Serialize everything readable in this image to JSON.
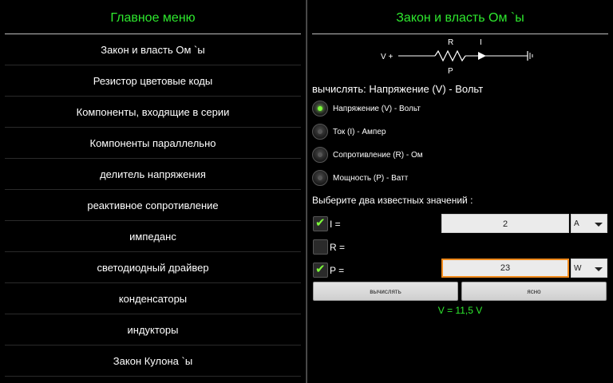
{
  "menu_pane": {
    "title": "Главное меню",
    "items": [
      "Закон и власть Ом `ы",
      "Резистор цветовые коды",
      "Компоненты, входящие в серии",
      "Компоненты параллельно",
      "делитель напряжения",
      "реактивное сопротивление",
      "импеданс",
      "светодиодный драйвер",
      "конденсаторы",
      "индукторы",
      "Закон Кулона `ы"
    ]
  },
  "calc_pane": {
    "title": "Закон и власть Ом `ы",
    "circuit": {
      "v_label": "V +",
      "r_label": "R",
      "i_label": "I",
      "p_label": "P"
    },
    "calc_header": "вычислять: Напряжение (V) - Вольт",
    "options": [
      {
        "label": "Напряжение (V) - Вольт",
        "selected": true
      },
      {
        "label": "Ток (I) - Ампер",
        "selected": false
      },
      {
        "label": "Сопротивление (R) - Ом",
        "selected": false
      },
      {
        "label": "Мощность (P) - Ватт",
        "selected": false
      }
    ],
    "choose_label": "Выберите два известных значений :",
    "inputs": {
      "i": {
        "label": "I =",
        "checked": true,
        "value": "2",
        "unit": "A"
      },
      "r": {
        "label": "R =",
        "checked": false
      },
      "p": {
        "label": "P =",
        "checked": true,
        "value": "23",
        "unit": "W"
      }
    },
    "calc_button": "вычислять",
    "clear_button": "ясно",
    "result": "V = 11,5 V"
  },
  "colors": {
    "accent_green": "#2ee82e",
    "radio_on": "#7dff3a",
    "focus_orange": "#f08a1c"
  }
}
